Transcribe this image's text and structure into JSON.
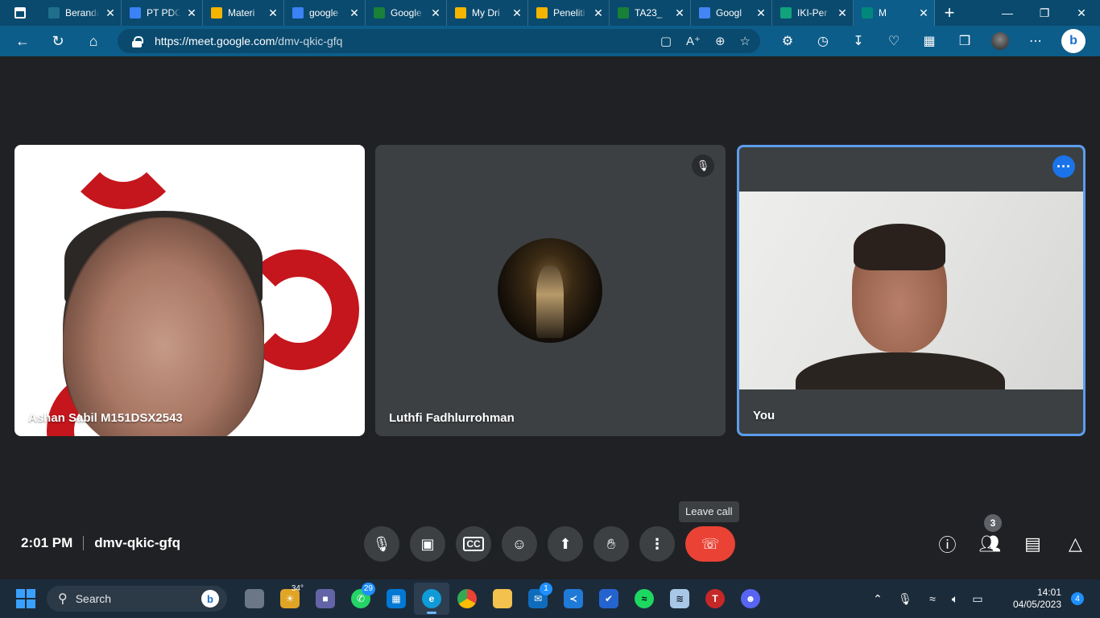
{
  "browser": {
    "tabs": [
      {
        "title": "Beranda",
        "favicon_color": "#1f6f8b"
      },
      {
        "title": "PT PDC",
        "favicon_color": "#3b82f6"
      },
      {
        "title": "Materi",
        "favicon_color": "#f4b400"
      },
      {
        "title": "google",
        "favicon_color": "#3b82f6"
      },
      {
        "title": "Google",
        "favicon_color": "#188038"
      },
      {
        "title": "My Dri",
        "favicon_color": "#f4b400"
      },
      {
        "title": "Peneliti",
        "favicon_color": "#f4b400"
      },
      {
        "title": "TA23_",
        "favicon_color": "#188038"
      },
      {
        "title": "Googl",
        "favicon_color": "#4285f4"
      },
      {
        "title": "IKI-Per",
        "favicon_color": "#12a37c"
      },
      {
        "title": "M",
        "favicon_color": "#00897b"
      }
    ],
    "url_host": "https://meet.google.com",
    "url_path": "/dmv-qkic-gfq"
  },
  "meet": {
    "participants": [
      {
        "name": "Ashan Sabil M151DSX2543"
      },
      {
        "name": "Luthfi Fadhlurrohman"
      },
      {
        "name": "You"
      }
    ],
    "tooltip": "Leave call",
    "time": "2:01 PM",
    "meeting_code": "dmv-qkic-gfq",
    "people_count": "3",
    "controls": [
      {
        "name": "microphone",
        "icon": "mic-icon"
      },
      {
        "name": "camera",
        "icon": "camera-icon"
      },
      {
        "name": "captions",
        "icon": "captions-icon"
      },
      {
        "name": "emoji",
        "icon": "emoji-icon"
      },
      {
        "name": "present",
        "icon": "present-icon"
      },
      {
        "name": "raise-hand",
        "icon": "hand-icon"
      },
      {
        "name": "more-options",
        "icon": "more-vert-icon"
      },
      {
        "name": "leave-call",
        "icon": "phone-hangup-icon"
      }
    ],
    "accent": "#1a73e8",
    "leave_color": "#ea4335"
  },
  "taskbar": {
    "search_placeholder": "Search",
    "weather_temp": "34°",
    "whatsapp_badge": "29",
    "mail_badge": "1",
    "clock_time": "14:01",
    "clock_date": "04/05/2023",
    "notifications": "4"
  }
}
